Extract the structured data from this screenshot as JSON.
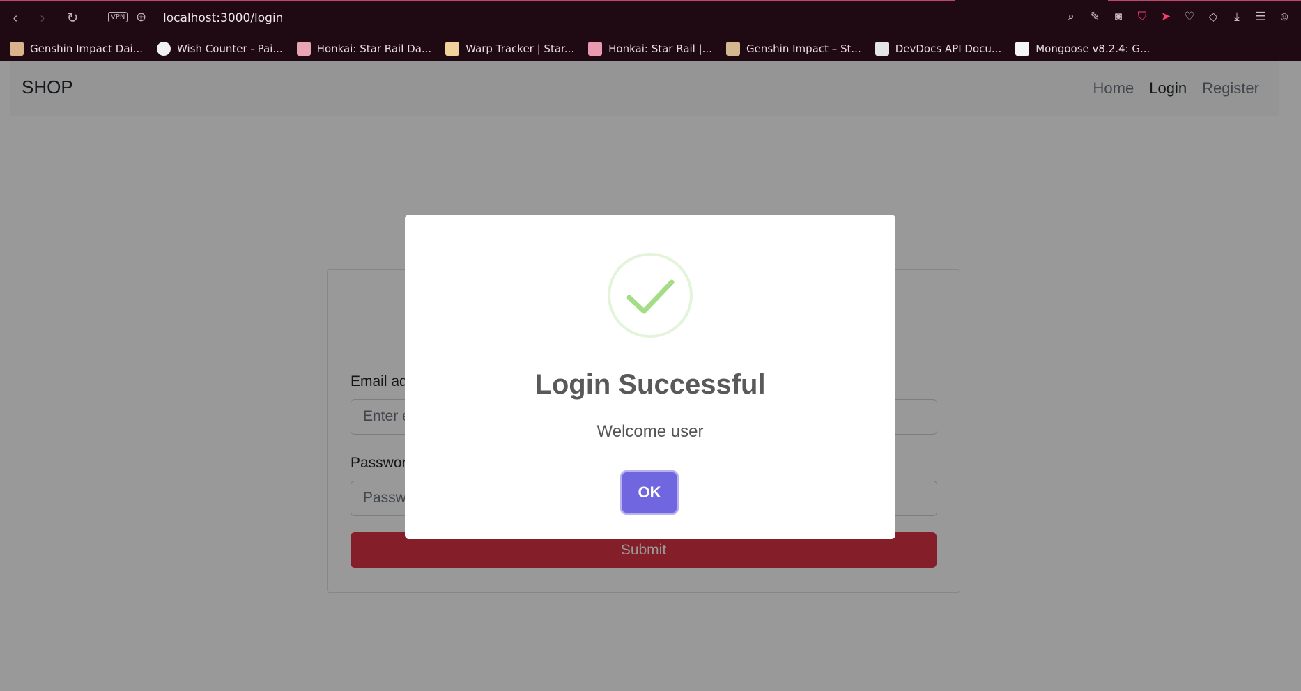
{
  "browser": {
    "vpn_label": "VPN",
    "url": "localhost:3000/login",
    "bookmarks": [
      {
        "label": "Genshin Impact Dai...",
        "color": "#d9b38c"
      },
      {
        "label": "Wish Counter - Pai...",
        "color": "#f0f0f0"
      },
      {
        "label": "Honkai: Star Rail Da...",
        "color": "#e8a3b5"
      },
      {
        "label": "Warp Tracker | Star...",
        "color": "#f2d29b"
      },
      {
        "label": "Honkai: Star Rail |...",
        "color": "#e89ab0"
      },
      {
        "label": "Genshin Impact – St...",
        "color": "#d4b890"
      },
      {
        "label": "DevDocs API Docu...",
        "color": "#e5e5e5"
      },
      {
        "label": "Mongoose v8.2.4: G...",
        "color": "#f5f5f5"
      }
    ]
  },
  "navbar": {
    "brand": "SHOP",
    "links": [
      "Home",
      "Login",
      "Register"
    ]
  },
  "form": {
    "email_label": "Email address",
    "email_placeholder": "Enter email",
    "password_label": "Password",
    "password_placeholder": "Password",
    "submit_label": "Submit"
  },
  "modal": {
    "title": "Login Successful",
    "text": "Welcome user",
    "ok_label": "OK",
    "icon": "success-check-icon"
  }
}
